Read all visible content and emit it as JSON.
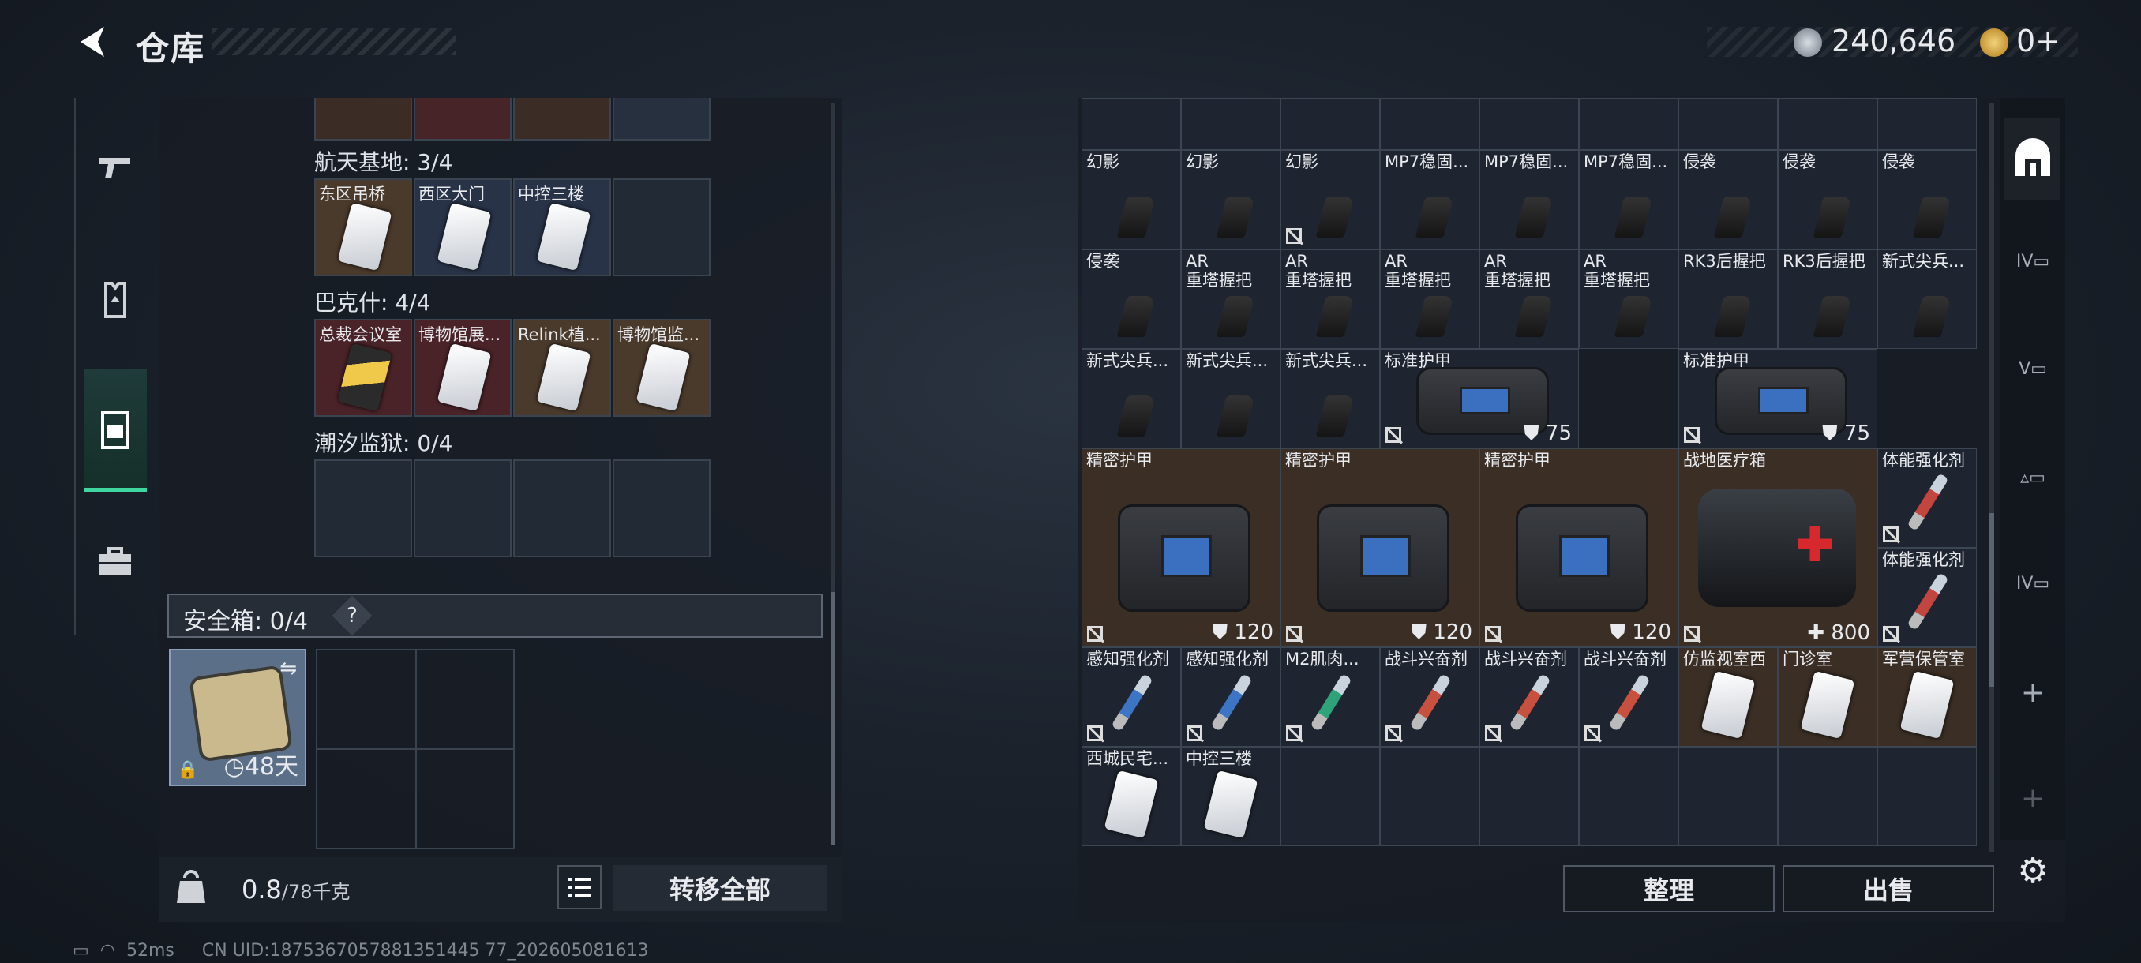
{
  "header": {
    "title": "仓库",
    "currency": "240,646",
    "tokens": "0+"
  },
  "left": {
    "sections": [
      {
        "label": "航天基地: 3/4",
        "slots": [
          "东区吊桥",
          "西区大门",
          "中控三楼",
          ""
        ]
      },
      {
        "label": "巴克什: 4/4",
        "slots": [
          "总裁会议室",
          "博物馆展...",
          "Relink植...",
          "博物馆监..."
        ]
      },
      {
        "label": "潮汐监狱: 0/4",
        "slots": [
          "",
          "",
          "",
          ""
        ]
      }
    ],
    "safe_label": "安全箱: 0/4",
    "safe_help": "?",
    "safe_days": "48天",
    "weight_value": "0.8",
    "weight_max": "/78千克",
    "transfer_all": "转移全部"
  },
  "right": {
    "row1": [
      "幻影",
      "幻影",
      "幻影",
      "MP7稳固...",
      "MP7稳固...",
      "MP7稳固...",
      "侵袭",
      "侵袭",
      "侵袭"
    ],
    "row2": [
      "侵袭",
      "AR\n重塔握把",
      "AR\n重塔握把",
      "AR\n重塔握把",
      "AR\n重塔握把",
      "AR\n重塔握把",
      "RK3后握把",
      "RK3后握把",
      "新式尖兵..."
    ],
    "row3_small": [
      "新式尖兵...",
      "新式尖兵...",
      "新式尖兵..."
    ],
    "armor_std": {
      "label": "标准护甲",
      "value": "75"
    },
    "armor_prec": {
      "label": "精密护甲",
      "value": "120"
    },
    "medkit": {
      "label": "战地医疗箱",
      "value": "800"
    },
    "stim": "体能强化剂",
    "row6": [
      "感知强化剂",
      "感知强化剂",
      "M2肌肉...",
      "战斗兴奋剂",
      "战斗兴奋剂",
      "战斗兴奋剂",
      "仿监视室西",
      "门诊室",
      "军营保管室"
    ],
    "row7": [
      "西城民宅...",
      "中控三楼"
    ],
    "sort": "整理",
    "sell": "出售"
  },
  "status": {
    "ping": "52ms",
    "uid": "CN UID:1875367057881351445 77_202605081613"
  },
  "colors": {
    "accent": "#3fd6a2",
    "rare_brown": "#4a3a2c",
    "rare_red": "#4a2328"
  }
}
